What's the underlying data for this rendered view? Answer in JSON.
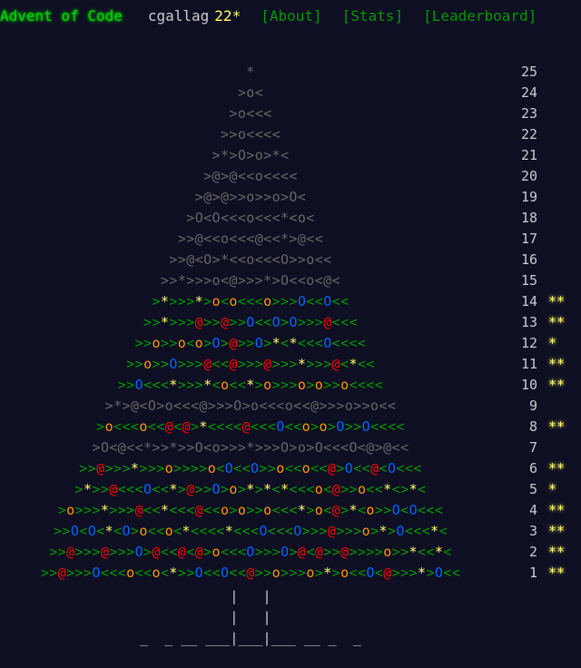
{
  "header": {
    "logo": "Advent of Code",
    "user": "cgallag",
    "star_count": "22*",
    "nav": [
      "[About]",
      "[Stats]",
      "[Leaderboard]"
    ]
  },
  "colors": {
    "background": "#0f0f23",
    "green": "#009900",
    "bright_green": "#00cc00",
    "gold": "#ffff66",
    "gray": "#666666"
  },
  "calendar": [
    {
      "day": "25",
      "art": "*",
      "stars": "",
      "style": "gray"
    },
    {
      "day": "24",
      "art": ">o<",
      "stars": "",
      "style": "gray"
    },
    {
      "day": "23",
      "art": ">o<<<",
      "stars": "",
      "style": "gray"
    },
    {
      "day": "22",
      "art": ">>o<<<<",
      "stars": "",
      "style": "gray"
    },
    {
      "day": "21",
      "art": ">*>O>o>*<",
      "stars": "",
      "style": "gray"
    },
    {
      "day": "20",
      "art": ">@>@<<o<<<<",
      "stars": "",
      "style": "gray"
    },
    {
      "day": "19",
      "art": ">@>@>>o>>o>O<",
      "stars": "",
      "style": "gray"
    },
    {
      "day": "18",
      "art": ">O<O<<<o<<<*<o<",
      "stars": "",
      "style": "gray"
    },
    {
      "day": "17",
      "art": ">>@<<o<<<@<<*>@<<",
      "stars": "",
      "style": "gray"
    },
    {
      "day": "16",
      "art": ">>@<O>*<<o<<<O>>o<<",
      "stars": "",
      "style": "gray"
    },
    {
      "day": "15",
      "art": ">>*>>>o<@>>>*>O<<o<@<",
      "stars": "",
      "style": "gray"
    },
    {
      "day": "14",
      "art": ">*>>>*>o<o<<<o>>>O<<O<<",
      "stars": "**",
      "style": "green"
    },
    {
      "day": "13",
      "art": ">>*>>>@>>@>>O<<O>O>>>@<<<",
      "stars": "**",
      "style": "green"
    },
    {
      "day": "12",
      "art": ">>o>>o<o>O>@>>O>*<*<<<O<<<<",
      "stars": "*",
      "style": "green"
    },
    {
      "day": "11",
      "art": ">>o>>O>>>@<<@>>>@>>>*>>>@<*<<",
      "stars": "**",
      "style": "green"
    },
    {
      "day": "10",
      "art": ">>O<<<*>>>*<o<<*>o>>>o>o>>o<<<<",
      "stars": "**",
      "style": "green"
    },
    {
      "day": "9",
      "art": ">*>@<O>o<<<@>>>O>o<<<o<<@>>>o>>o<<",
      "stars": "",
      "style": "gray"
    },
    {
      "day": "8",
      "art": ">o<<<o<<@<@>*<<<<@<<<O<<o>o>O>>O<<<<",
      "stars": "**",
      "style": "green"
    },
    {
      "day": "7",
      "art": ">O<@<<*>>*>>O<o>>>*>>>O>o>O<<<O<@>@<<",
      "stars": "",
      "style": "gray"
    },
    {
      "day": "6",
      "art": ">>@>>>*>>>o>>>>o<O<<O>>o<<o<<@>O<<@<O<<<",
      "stars": "**",
      "style": "green"
    },
    {
      "day": "5",
      "art": ">*>>@<<<O<<*>@>>O>o>*>*<*<<<o<@>>o<<*<>*<",
      "stars": "*",
      "style": "green"
    },
    {
      "day": "4",
      "art": ">o>>>*>>>@<<*<<<@<<o>o>>o<<<*>o<@>*<o>>O<O<<<",
      "stars": "**",
      "style": "green"
    },
    {
      "day": "3",
      "art": ">>O<O<*<O>o<<o<*<<<<*<<<O<<<O>>>@>>>o>*>O<<<*<",
      "stars": "**",
      "style": "green"
    },
    {
      "day": "2",
      "art": ">>@>>>@>>>O>@<<@<@>o<<<O>>>O>@<@>>@>>>>o>>*<<*<",
      "stars": "**",
      "style": "green"
    },
    {
      "day": "1",
      "art": ">>@>>>O<<<o<<o<*>>O<<O<<@>>o>>>o>*>o<<O<@>>>*>O<<",
      "stars": "**",
      "style": "green"
    }
  ],
  "trunk": [
    "|   |",
    "|   |",
    "_  _ __ ___|___|___ __ _  _"
  ]
}
